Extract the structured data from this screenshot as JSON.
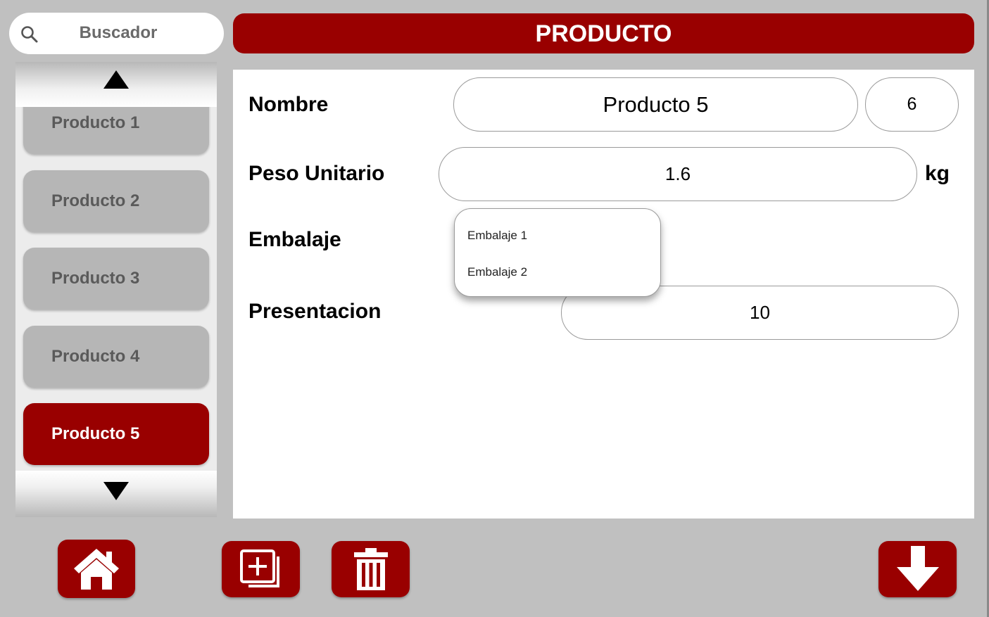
{
  "search": {
    "placeholder": "Buscador",
    "icon": "search-icon"
  },
  "sidebar": {
    "items": [
      {
        "label": "Producto 1"
      },
      {
        "label": "Producto 2"
      },
      {
        "label": "Producto 3"
      },
      {
        "label": "Producto 4"
      },
      {
        "label": "Producto 5"
      }
    ],
    "selected_label": "Producto 5"
  },
  "header": {
    "title": "PRODUCTO"
  },
  "form": {
    "nombre_label": "Nombre",
    "nombre_value": "Producto 5",
    "nombre_id": "6",
    "peso_label": "Peso Unitario",
    "peso_value": "1.6",
    "peso_unit": "kg",
    "embalaje_label": "Embalaje",
    "embalaje_options": [
      "Embalaje 1",
      "Embalaje 2"
    ],
    "presentacion_label": "Presentacion",
    "presentacion_value": "10"
  },
  "toolbar": {
    "home_icon": "home-icon",
    "add_icon": "add-copy-icon",
    "delete_icon": "trash-icon",
    "save_icon": "arrow-down-icon"
  },
  "colors": {
    "accent": "#990000",
    "background": "#c0c0c0",
    "item": "#b6b6b6"
  }
}
